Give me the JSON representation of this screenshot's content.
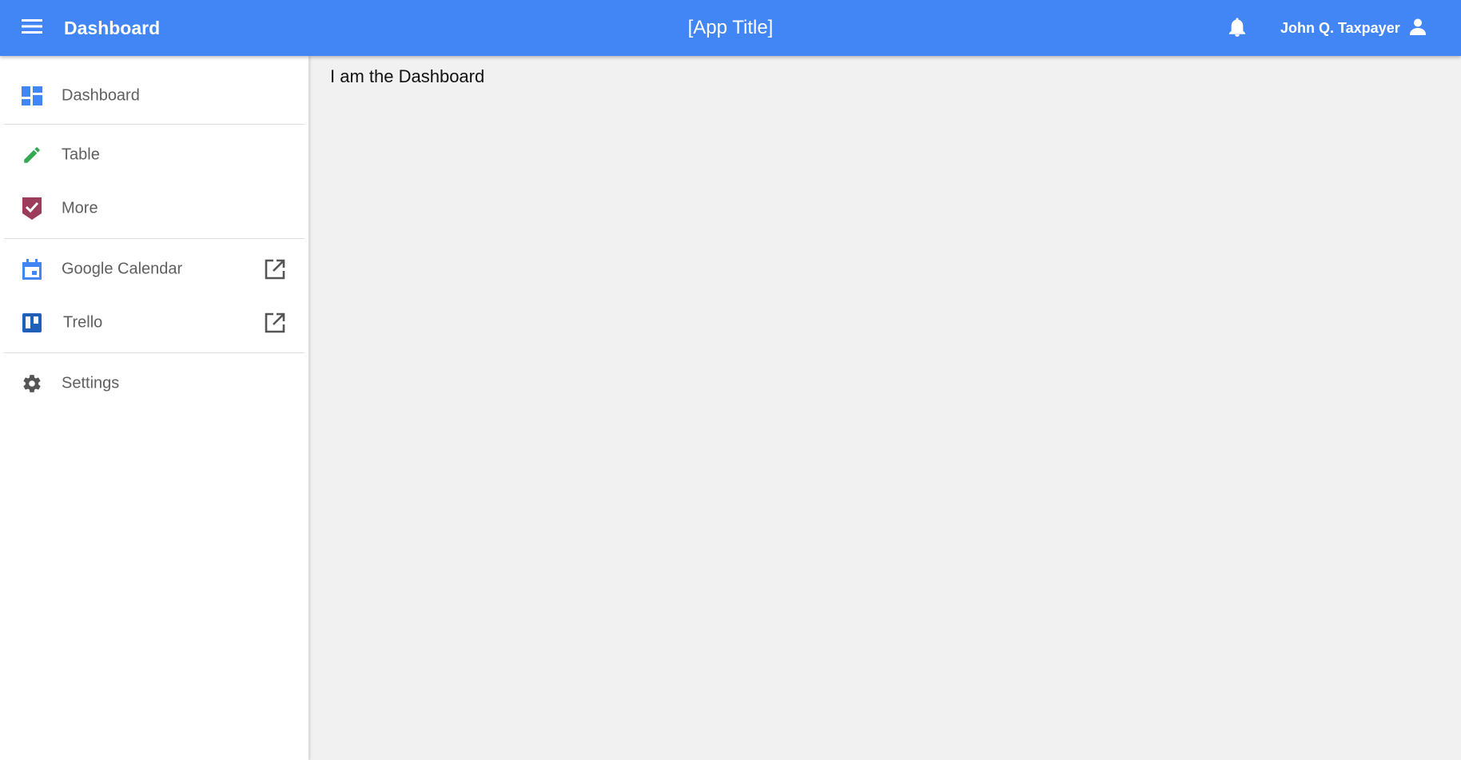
{
  "header": {
    "brand": "Dashboard",
    "app_title": "[App Title]",
    "user_name": "John Q. Taxpayer",
    "background_color": "#4285f4",
    "icons": {
      "menu": "hamburger-menu-icon",
      "notifications": "bell-icon",
      "user": "person-icon"
    }
  },
  "sidebar": {
    "items": [
      {
        "label": "Dashboard",
        "icon": "dashboard-icon",
        "icon_color": "#4285f4"
      },
      {
        "label": "Table",
        "icon": "pencil-icon",
        "icon_color": "#34a853"
      },
      {
        "label": "More",
        "icon": "shield-check-icon",
        "icon_color": "#9c3b5a"
      },
      {
        "label": "Google Calendar",
        "icon": "calendar-icon",
        "icon_color": "#4285f4",
        "external": true
      },
      {
        "label": "Trello",
        "icon": "trello-icon",
        "icon_color": "#1f5fb8",
        "external": true
      },
      {
        "label": "Settings",
        "icon": "gear-icon",
        "icon_color": "#555555"
      }
    ]
  },
  "main": {
    "text": "I am the Dashboard"
  }
}
